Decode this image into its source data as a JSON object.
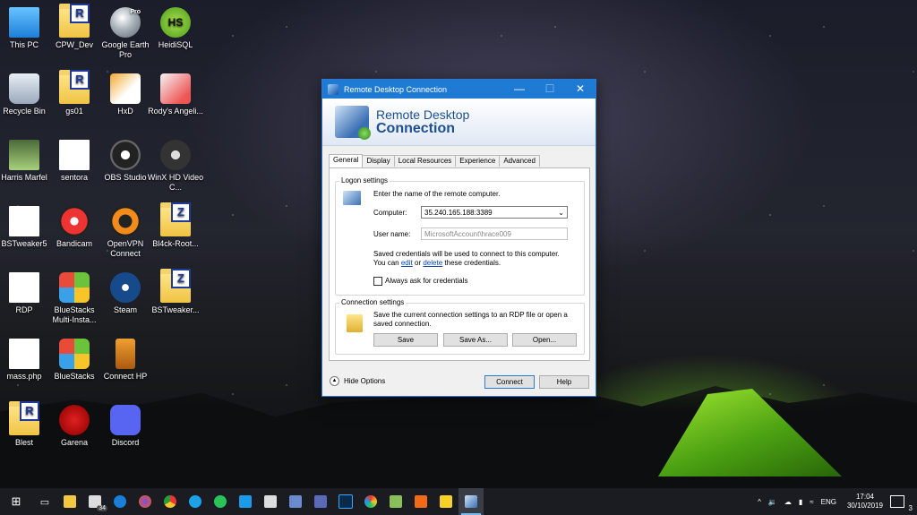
{
  "desktop": {
    "icons": [
      {
        "label": "This PC"
      },
      {
        "label": "CPW_Dev"
      },
      {
        "label": "Google Earth Pro"
      },
      {
        "label": "HeidiSQL"
      },
      {
        "label": "Recycle Bin"
      },
      {
        "label": "gs01"
      },
      {
        "label": "HxD"
      },
      {
        "label": "Rody's Angeli..."
      },
      {
        "label": "Harris Marfel"
      },
      {
        "label": "sentora"
      },
      {
        "label": "OBS Studio"
      },
      {
        "label": "WinX HD Video C..."
      },
      {
        "label": "BSTweaker5"
      },
      {
        "label": "Bandicam"
      },
      {
        "label": "OpenVPN Connect"
      },
      {
        "label": "Bl4ck-Root..."
      },
      {
        "label": "RDP"
      },
      {
        "label": "BlueStacks Multi-Insta..."
      },
      {
        "label": "Steam"
      },
      {
        "label": "BSTweaker..."
      },
      {
        "label": "mass.php"
      },
      {
        "label": "BlueStacks"
      },
      {
        "label": "Connect HP"
      },
      {
        "label": "Blest"
      },
      {
        "label": "Garena"
      },
      {
        "label": "Discord"
      }
    ],
    "badge_letters": {
      "r": "R",
      "z": "Z",
      "hs": "HS",
      "pro": "Pro"
    }
  },
  "window": {
    "title": "Remote Desktop Connection",
    "controls": {
      "minimize": "—",
      "maximize": "☐",
      "close": "✕"
    },
    "banner_line1": "Remote Desktop",
    "banner_line2": "Connection",
    "tabs": [
      "General",
      "Display",
      "Local Resources",
      "Experience",
      "Advanced"
    ],
    "logon": {
      "group_title": "Logon settings",
      "prompt": "Enter the name of the remote computer.",
      "computer_label": "Computer:",
      "computer_value": "35.240.165.188:3389",
      "username_label": "User name:",
      "username_value": "MicrosoftAccount\\hrace009",
      "saved_line1": "Saved credentials will be used to connect to this computer.",
      "saved_you_can": "You can",
      "edit_link": "edit",
      "or_text": "or",
      "delete_link": "delete",
      "saved_tail": "these credentials.",
      "always_ask": "Always ask for credentials"
    },
    "connection": {
      "group_title": "Connection settings",
      "description": "Save the current connection settings to an RDP file or open a saved connection.",
      "save": "Save",
      "save_as": "Save As...",
      "open": "Open..."
    },
    "hide_options": "Hide Options",
    "connect": "Connect",
    "help": "Help"
  },
  "taskbar": {
    "mail_badge": "34",
    "language": "ENG",
    "time": "17:04",
    "date": "30/10/2019",
    "notifications": "3",
    "tray_chevron": "^"
  }
}
